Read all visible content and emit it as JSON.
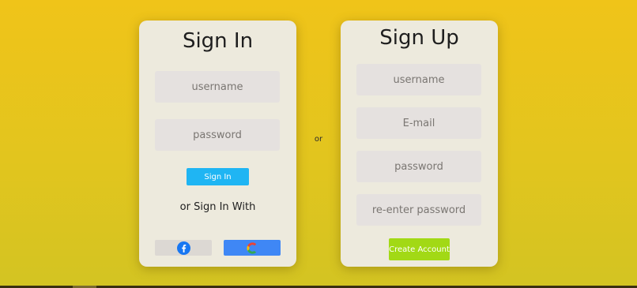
{
  "signin": {
    "title": "Sign In",
    "username_placeholder": "username",
    "password_placeholder": "password",
    "submit_label": "Sign In",
    "alt_text": "or Sign In With",
    "social": [
      {
        "name": "facebook",
        "icon": "facebook-icon",
        "color": "#1877f2"
      },
      {
        "name": "google",
        "icon": "google-icon",
        "color": "#3f87f5"
      }
    ]
  },
  "separator": "or",
  "signup": {
    "title": "Sign Up",
    "username_placeholder": "username",
    "email_placeholder": "E-mail",
    "password_placeholder": "password",
    "reenter_placeholder": "re-enter password",
    "submit_label": "Create Account"
  },
  "colors": {
    "background": "#f0c419",
    "card": "#edeadd",
    "signin_button": "#1fb5f3",
    "create_button": "#a2d915"
  }
}
